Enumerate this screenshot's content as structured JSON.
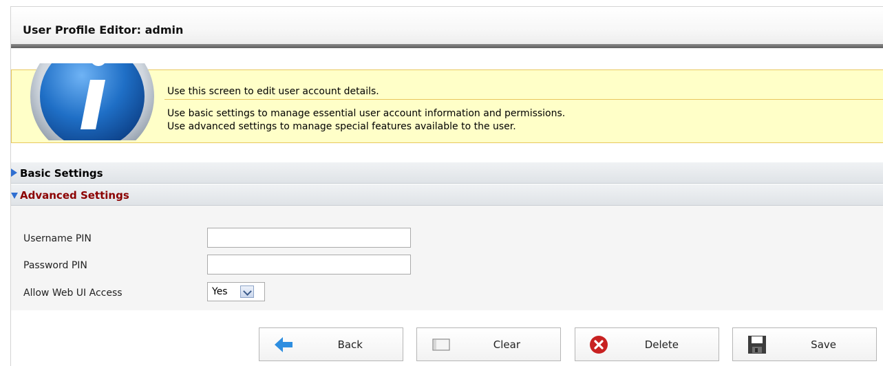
{
  "header": {
    "title": "User Profile Editor: admin"
  },
  "info": {
    "icon": "info-icon",
    "line1": "Use this screen to edit user account details.",
    "line2": "Use basic settings to manage essential user account information and permissions.",
    "line3": "Use advanced settings to manage special features available to the user."
  },
  "sections": {
    "basic": "Basic Settings",
    "advanced": "Advanced Settings"
  },
  "form": {
    "username_pin": {
      "label": "Username PIN",
      "value": ""
    },
    "password_pin": {
      "label": "Password PIN",
      "value": ""
    },
    "web_ui": {
      "label": "Allow Web UI Access",
      "value": "Yes"
    }
  },
  "buttons": {
    "back": "Back",
    "clear": "Clear",
    "delete": "Delete",
    "save": "Save"
  },
  "colors": {
    "info_bg": "#ffffc8",
    "info_border": "#e8c75d",
    "advanced_label": "#8b0000",
    "triangle": "#2f6fd1"
  }
}
